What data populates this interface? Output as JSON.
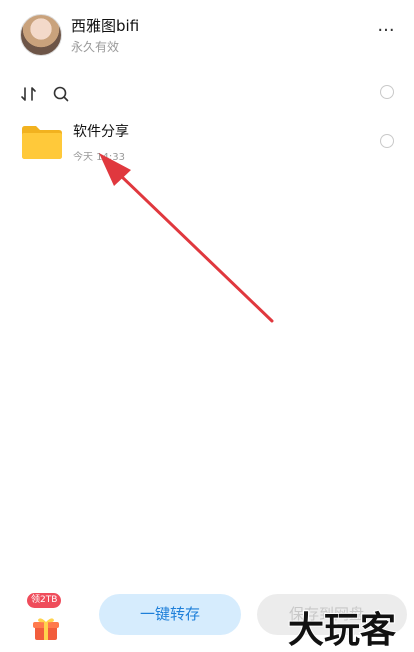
{
  "header": {
    "user_name": "西雅图bifi",
    "validity": "永久有效",
    "more_icon": "more-dots-icon"
  },
  "toolbar": {
    "sort_icon": "sort-icon",
    "search_icon": "search-icon"
  },
  "files": [
    {
      "name": "软件分享",
      "modified": "今天 14:33",
      "type": "folder"
    }
  ],
  "bottom": {
    "gift_badge": "领2TB",
    "save_button": "一键转存",
    "netdisk_button": "保存到网盘"
  },
  "watermark": "大玩客",
  "colors": {
    "accent_blue": "#1e7fd9",
    "primary_button_bg": "#d6ecfd",
    "folder_yellow": "#f7c02b",
    "annotation_red": "#e0383e",
    "badge_red": "#ef4c5b"
  }
}
